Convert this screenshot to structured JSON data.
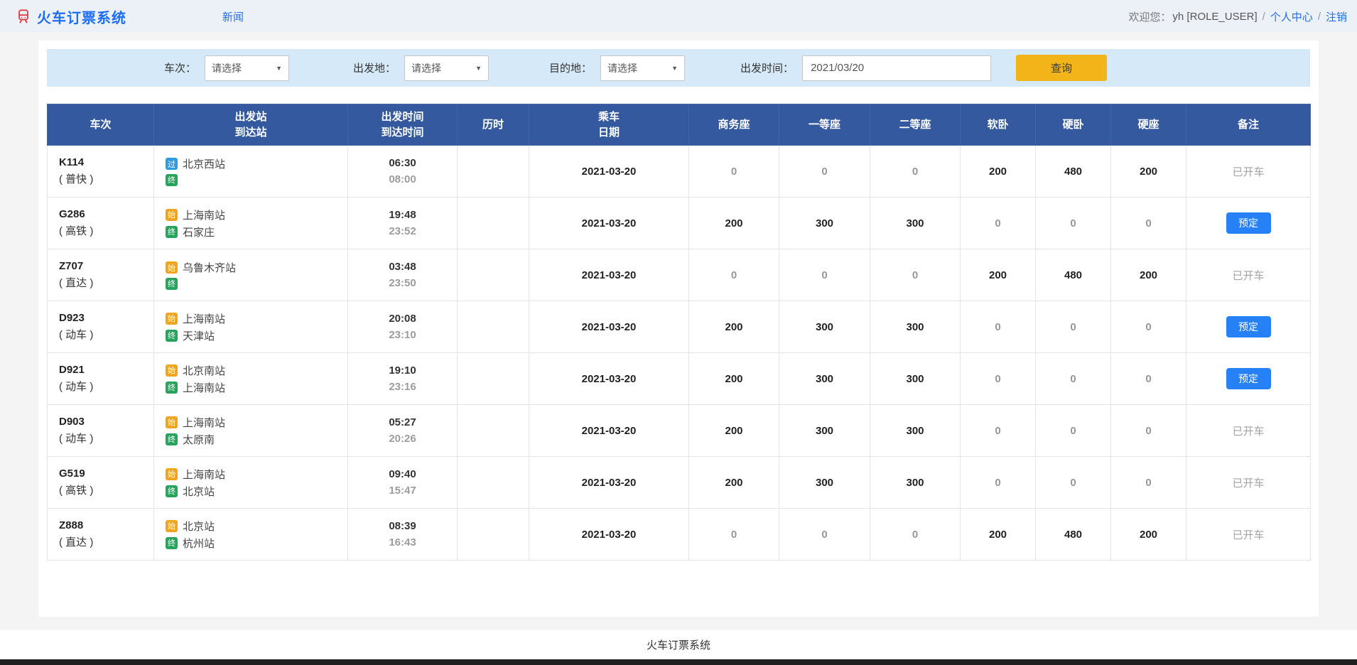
{
  "header": {
    "title": "火车订票系统",
    "nav_news": "新闻",
    "welcome_prefix": "欢迎您：",
    "username": "yh [ROLE_USER]",
    "separator": "/",
    "profile_link": "个人中心",
    "logout_link": "注销"
  },
  "search": {
    "fields": [
      {
        "label": "车次：",
        "value": "请选择"
      },
      {
        "label": "出发地：",
        "value": "请选择"
      },
      {
        "label": "目的地：",
        "value": "请选择"
      },
      {
        "label": "出发时间：",
        "value": "2021/03/20"
      }
    ],
    "submit_label": "查询"
  },
  "table": {
    "columns": [
      [
        "车次"
      ],
      [
        "出发站",
        "到达站"
      ],
      [
        "出发时间",
        "到达时间"
      ],
      [
        "历时"
      ],
      [
        "乘车",
        "日期"
      ],
      [
        "商务座"
      ],
      [
        "一等座"
      ],
      [
        "二等座"
      ],
      [
        "软卧"
      ],
      [
        "硬卧"
      ],
      [
        "硬座"
      ],
      [
        "备注"
      ]
    ],
    "seat_keys": [
      "business-seat",
      "first-class-seat",
      "second-class-seat",
      "soft-sleeper",
      "hard-sleeper",
      "hard-seat"
    ],
    "badge_colors": {
      "始": "#f0a51d",
      "终": "#27a45c",
      "过": "#2e9ce1"
    },
    "rows": [
      {
        "train_no": "K114",
        "train_type": "( 普快 )",
        "stations": [
          {
            "badge": "过",
            "name": "北京西站"
          },
          {
            "badge": "终",
            "name": ""
          }
        ],
        "depart_time": "06:30",
        "arrive_time": "08:00",
        "duration": "",
        "date": "2021-03-20",
        "seats": [
          "0",
          "0",
          "0",
          "200",
          "480",
          "200"
        ],
        "action": {
          "kind": "text",
          "label": "已开车"
        }
      },
      {
        "train_no": "G286",
        "train_type": "( 高铁 )",
        "stations": [
          {
            "badge": "始",
            "name": "上海南站"
          },
          {
            "badge": "终",
            "name": "石家庄"
          }
        ],
        "depart_time": "19:48",
        "arrive_time": "23:52",
        "duration": "",
        "date": "2021-03-20",
        "seats": [
          "200",
          "300",
          "300",
          "0",
          "0",
          "0"
        ],
        "action": {
          "kind": "button",
          "label": "预定"
        }
      },
      {
        "train_no": "Z707",
        "train_type": "( 直达 )",
        "stations": [
          {
            "badge": "始",
            "name": "乌鲁木齐站"
          },
          {
            "badge": "终",
            "name": ""
          }
        ],
        "depart_time": "03:48",
        "arrive_time": "23:50",
        "duration": "",
        "date": "2021-03-20",
        "seats": [
          "0",
          "0",
          "0",
          "200",
          "480",
          "200"
        ],
        "action": {
          "kind": "text",
          "label": "已开车"
        }
      },
      {
        "train_no": "D923",
        "train_type": "( 动车 )",
        "stations": [
          {
            "badge": "始",
            "name": "上海南站"
          },
          {
            "badge": "终",
            "name": "天津站"
          }
        ],
        "depart_time": "20:08",
        "arrive_time": "23:10",
        "duration": "",
        "date": "2021-03-20",
        "seats": [
          "200",
          "300",
          "300",
          "0",
          "0",
          "0"
        ],
        "action": {
          "kind": "button",
          "label": "预定"
        }
      },
      {
        "train_no": "D921",
        "train_type": "( 动车 )",
        "stations": [
          {
            "badge": "始",
            "name": "北京南站"
          },
          {
            "badge": "终",
            "name": "上海南站"
          }
        ],
        "depart_time": "19:10",
        "arrive_time": "23:16",
        "duration": "",
        "date": "2021-03-20",
        "seats": [
          "200",
          "300",
          "300",
          "0",
          "0",
          "0"
        ],
        "action": {
          "kind": "button",
          "label": "预定"
        }
      },
      {
        "train_no": "D903",
        "train_type": "( 动车 )",
        "stations": [
          {
            "badge": "始",
            "name": "上海南站"
          },
          {
            "badge": "终",
            "name": "太原南"
          }
        ],
        "depart_time": "05:27",
        "arrive_time": "20:26",
        "duration": "",
        "date": "2021-03-20",
        "seats": [
          "200",
          "300",
          "300",
          "0",
          "0",
          "0"
        ],
        "action": {
          "kind": "text",
          "label": "已开车"
        }
      },
      {
        "train_no": "G519",
        "train_type": "( 高铁 )",
        "stations": [
          {
            "badge": "始",
            "name": "上海南站"
          },
          {
            "badge": "终",
            "name": "北京站"
          }
        ],
        "depart_time": "09:40",
        "arrive_time": "15:47",
        "duration": "",
        "date": "2021-03-20",
        "seats": [
          "200",
          "300",
          "300",
          "0",
          "0",
          "0"
        ],
        "action": {
          "kind": "text",
          "label": "已开车"
        }
      },
      {
        "train_no": "Z888",
        "train_type": "( 直达 )",
        "stations": [
          {
            "badge": "始",
            "name": "北京站"
          },
          {
            "badge": "终",
            "name": "杭州站"
          }
        ],
        "depart_time": "08:39",
        "arrive_time": "16:43",
        "duration": "",
        "date": "2021-03-20",
        "seats": [
          "0",
          "0",
          "0",
          "200",
          "480",
          "200"
        ],
        "action": {
          "kind": "text",
          "label": "已开车"
        }
      }
    ]
  },
  "footer": {
    "text": "火车订票系统"
  },
  "theme": {
    "table_header_bg": "#35599e",
    "search_panel_bg": "#d6e9f8",
    "search_button_yellow": "#f2b418",
    "book_button_blue": "#2680f6",
    "link_blue": "#1e6ef5",
    "logo_red": "#e03c3c"
  }
}
